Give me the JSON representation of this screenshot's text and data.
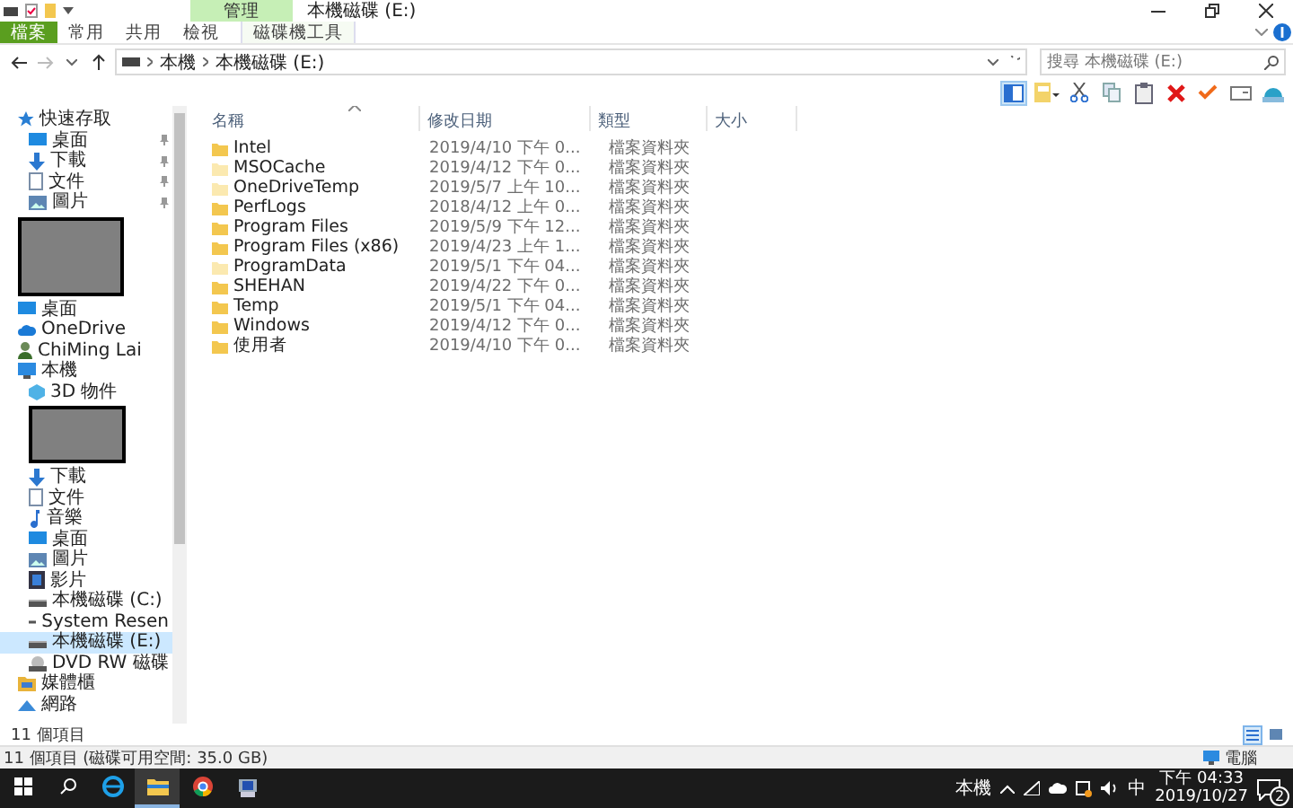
{
  "window": {
    "title": "本機磁碟 (E:)",
    "context_group": "管理"
  },
  "ribbon_tabs": [
    {
      "label": "檔案",
      "kind": "file"
    },
    {
      "label": "常用",
      "kind": "normal"
    },
    {
      "label": "共用",
      "kind": "normal"
    },
    {
      "label": "檢視",
      "kind": "normal"
    },
    {
      "label": "磁碟機工具",
      "kind": "context"
    }
  ],
  "address": {
    "path": [
      "本機",
      "本機磁碟 (E:)"
    ],
    "forward_disabled": true
  },
  "search": {
    "placeholder": "搜尋 本機磁碟 (E:)"
  },
  "toolbar": {
    "layout_pane_selected": true
  },
  "sidebar": [
    {
      "label": "快速存取",
      "kind": "star",
      "selected": false,
      "children": [
        {
          "label": "桌面",
          "kind": "desktop",
          "pinned": true,
          "selected": false
        },
        {
          "label": "下載",
          "kind": "download",
          "pinned": true,
          "selected": false
        },
        {
          "label": "文件",
          "kind": "document",
          "pinned": true,
          "selected": false
        },
        {
          "label": "圖片",
          "kind": "picture",
          "pinned": true,
          "selected": false
        }
      ]
    },
    {
      "kind": "photo",
      "selected": false
    },
    {
      "label": "桌面",
      "kind": "desktop",
      "selected": false
    },
    {
      "label": "OneDrive",
      "kind": "cloud",
      "selected": false
    },
    {
      "label": "ChiMing Lai",
      "kind": "user",
      "selected": false
    },
    {
      "label": "本機",
      "kind": "computer",
      "selected": false,
      "children": [
        {
          "label": "3D 物件",
          "kind": "cube",
          "selected": false
        },
        {
          "kind": "photo",
          "selected": false
        },
        {
          "label": "下載",
          "kind": "download",
          "selected": false
        },
        {
          "label": "文件",
          "kind": "document",
          "selected": false
        },
        {
          "label": "音樂",
          "kind": "music",
          "selected": false
        },
        {
          "label": "桌面",
          "kind": "desktop",
          "selected": false
        },
        {
          "label": "圖片",
          "kind": "picture",
          "selected": false
        },
        {
          "label": "影片",
          "kind": "video",
          "selected": false
        },
        {
          "label": "本機磁碟 (C:)",
          "kind": "drive",
          "selected": false
        },
        {
          "label": "System Resen",
          "kind": "drive",
          "selected": false
        },
        {
          "label": "本機磁碟 (E:)",
          "kind": "drive",
          "selected": true
        },
        {
          "label": "DVD RW 磁碟",
          "kind": "dvd",
          "selected": false
        }
      ]
    },
    {
      "label": "媒體櫃",
      "kind": "library",
      "selected": false
    },
    {
      "label": "網路",
      "kind": "network",
      "selected": false
    }
  ],
  "columns": [
    {
      "label": "名稱",
      "sorted": true
    },
    {
      "label": "修改日期",
      "sorted": false
    },
    {
      "label": "類型",
      "sorted": false
    },
    {
      "label": "大小",
      "sorted": false
    }
  ],
  "rows": [
    {
      "name": "Intel",
      "modified": "2019/4/10 下午 0...",
      "type": "檔案資料夾",
      "hidden": false,
      "selected": false
    },
    {
      "name": "MSOCache",
      "modified": "2019/4/12 下午 0...",
      "type": "檔案資料夾",
      "hidden": true,
      "selected": false
    },
    {
      "name": "OneDriveTemp",
      "modified": "2019/5/7 上午 10...",
      "type": "檔案資料夾",
      "hidden": true,
      "selected": false
    },
    {
      "name": "PerfLogs",
      "modified": "2018/4/12 上午 0...",
      "type": "檔案資料夾",
      "hidden": false,
      "selected": false
    },
    {
      "name": "Program Files",
      "modified": "2019/5/9 下午 12...",
      "type": "檔案資料夾",
      "hidden": false,
      "selected": false
    },
    {
      "name": "Program Files (x86)",
      "modified": "2019/4/23 上午 1...",
      "type": "檔案資料夾",
      "hidden": false,
      "selected": false
    },
    {
      "name": "ProgramData",
      "modified": "2019/5/1 下午 04...",
      "type": "檔案資料夾",
      "hidden": true,
      "selected": false
    },
    {
      "name": "SHEHAN",
      "modified": "2019/4/22 下午 0...",
      "type": "檔案資料夾",
      "hidden": false,
      "selected": false
    },
    {
      "name": "Temp",
      "modified": "2019/5/1 下午 04...",
      "type": "檔案資料夾",
      "hidden": false,
      "selected": false
    },
    {
      "name": "Windows",
      "modified": "2019/4/12 下午 0...",
      "type": "檔案資料夾",
      "hidden": false,
      "selected": false
    },
    {
      "name": "使用者",
      "modified": "2019/4/10 下午 0...",
      "type": "檔案資料夾",
      "hidden": false,
      "selected": false
    }
  ],
  "item_count": "11 個項目",
  "views": [
    {
      "kind": "details",
      "selected": true
    },
    {
      "kind": "large",
      "selected": false
    }
  ],
  "status_bar": {
    "left": "11 個項目 (磁碟可用空間: 35.0 GB)",
    "right": "電腦"
  },
  "taskbar": {
    "apps": [
      {
        "kind": "start",
        "active": false
      },
      {
        "kind": "search",
        "active": false
      },
      {
        "kind": "browser-e",
        "active": false
      },
      {
        "kind": "folder",
        "active": true
      },
      {
        "kind": "browser-ring",
        "active": false
      },
      {
        "kind": "monitor",
        "active": false
      }
    ],
    "location": "本機",
    "ime": "中",
    "time": "下午 04:33",
    "date": "2019/10/27",
    "notifications": "2"
  }
}
